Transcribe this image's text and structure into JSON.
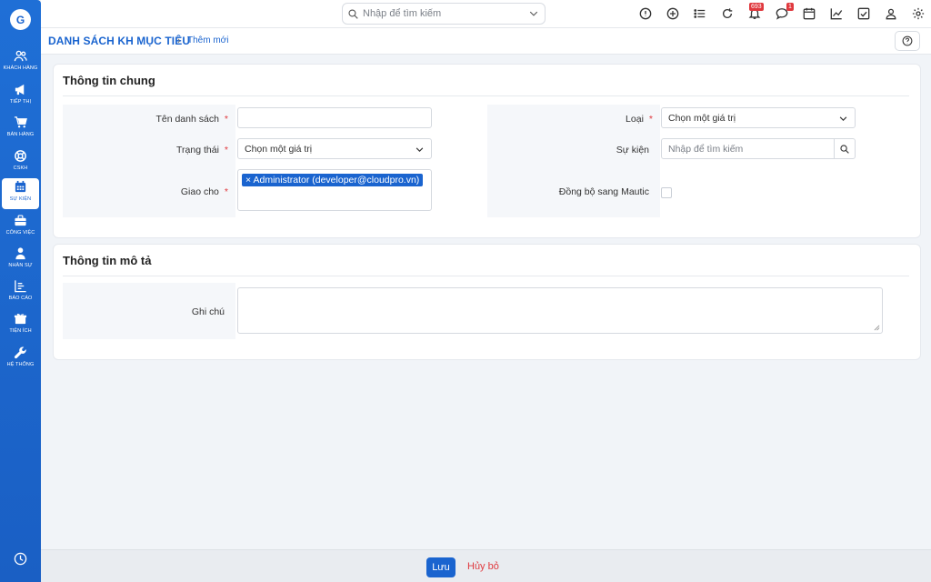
{
  "sidebar": {
    "logo_text": "G",
    "items": [
      {
        "label": "KHÁCH HÀNG",
        "icon": "users-icon",
        "active": false
      },
      {
        "label": "TIẾP THỊ",
        "icon": "megaphone-icon",
        "active": false
      },
      {
        "label": "BÁN HÀNG",
        "icon": "cart-icon",
        "active": false
      },
      {
        "label": "CSKH",
        "icon": "lifebuoy-icon",
        "active": false
      },
      {
        "label": "SỰ KIỆN",
        "icon": "calendar-icon",
        "active": true
      },
      {
        "label": "CÔNG VIỆC",
        "icon": "briefcase-icon",
        "active": false
      },
      {
        "label": "NHÂN SỰ",
        "icon": "person-icon",
        "active": false
      },
      {
        "label": "BÁO CÁO",
        "icon": "report-icon",
        "active": false
      },
      {
        "label": "TIỆN ÍCH",
        "icon": "box-icon",
        "active": false
      },
      {
        "label": "HỆ THỐNG",
        "icon": "wrench-icon",
        "active": false
      }
    ]
  },
  "topbar": {
    "search_placeholder": "Nhập để tìm kiếm",
    "notification_count": "693",
    "message_count": "1"
  },
  "breadcrumb": {
    "main": "DANH SÁCH KH MỤC TIÊU",
    "separator": "›",
    "current": "Thêm mới"
  },
  "general": {
    "title": "Thông tin chung",
    "required_mark": "*",
    "name_label": "Tên danh sách",
    "name_value": "",
    "status_label": "Trạng thái",
    "status_value": "Chọn một giá trị",
    "assign_label": "Giao cho",
    "assign_tag": "Administrator (developer@cloudpro.vn)",
    "assign_tag_remove": "×",
    "type_label": "Loại",
    "type_value": "Chọn một giá trị",
    "event_label": "Sự kiện",
    "event_placeholder": "Nhập để tìm kiếm",
    "sync_label": "Đồng bộ sang Mautic",
    "sync_checked": false
  },
  "description": {
    "title": "Thông tin mô tả",
    "note_label": "Ghi chú",
    "note_value": ""
  },
  "footer": {
    "save_label": "Lưu",
    "cancel_label": "Hủy bỏ"
  },
  "colors": {
    "primary": "#1a64cf",
    "danger": "#e0393e",
    "background": "#f1f4f8"
  }
}
